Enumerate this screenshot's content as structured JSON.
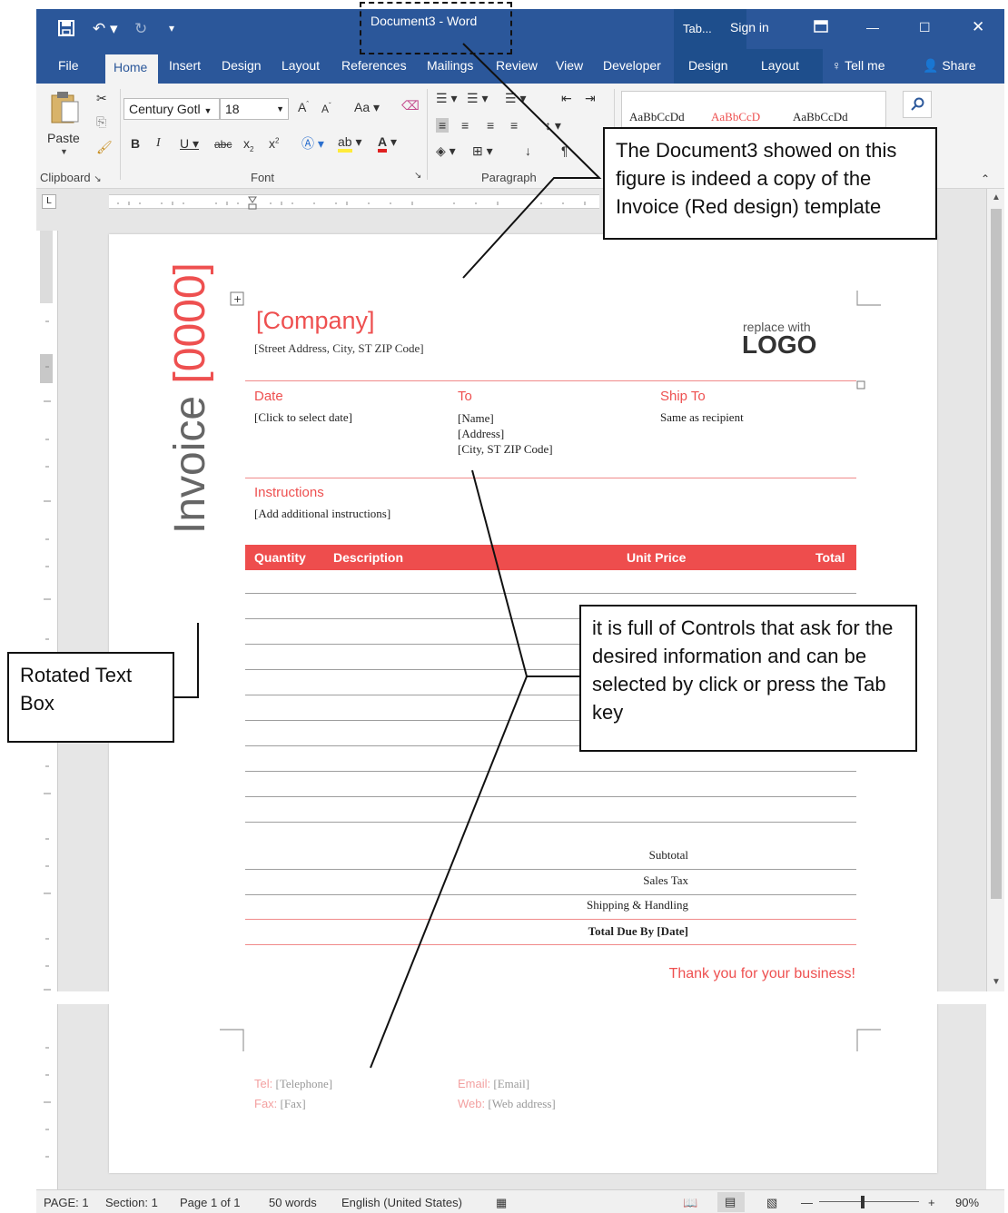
{
  "window": {
    "title": "Document3  -  Word",
    "context_tab_label": "Tab...",
    "sign_in": "Sign in"
  },
  "ribbon_tabs": [
    "File",
    "Home",
    "Insert",
    "Design",
    "Layout",
    "References",
    "Mailings",
    "Review",
    "View",
    "Developer",
    "Design",
    "Layout"
  ],
  "tell_me": "Tell me",
  "share": "Share",
  "clipboard": {
    "paste_label": "Paste",
    "group_label": "Clipboard"
  },
  "font": {
    "font_name": "Century Gotl",
    "font_size": "18",
    "change_case": "Aa",
    "group_label": "Font"
  },
  "paragraph": {
    "group_label": "Paragraph"
  },
  "styles": [
    "AaBbCcDd",
    "AaBbCcD",
    "AaBbCcDd"
  ],
  "invoice": {
    "title_word": "Invoice",
    "title_number": "[0000]",
    "company": "[Company]",
    "address": "[Street Address, City, ST ZIP Code]",
    "logo_top": "replace with",
    "logo": "LOGO",
    "date_label": "Date",
    "date_value": "[Click to select date]",
    "to_label": "To",
    "to_lines": [
      "[Name]",
      "[Address]",
      "[City, ST  ZIP Code]"
    ],
    "ship_label": "Ship To",
    "ship_value": "Same as recipient",
    "instructions_label": "Instructions",
    "instructions_value": "[Add additional instructions]",
    "table_headers": [
      "Quantity",
      "Description",
      "Unit Price",
      "Total"
    ],
    "summary": [
      "Subtotal",
      "Sales Tax",
      "Shipping & Handling",
      "Total Due By [Date]"
    ],
    "thanks": "Thank you for your business!",
    "footer": {
      "tel_label": "Tel:",
      "tel_value": "[Telephone]",
      "fax_label": "Fax:",
      "fax_value": "[Fax]",
      "email_label": "Email:",
      "email_value": "[Email]",
      "web_label": "Web:",
      "web_value": "[Web address]"
    }
  },
  "callouts": {
    "top": "The Document3 showed on this figure is indeed a copy of the Invoice (Red design) template",
    "middle": "it is full of Controls that ask for the desired information and can be selected by click or press the Tab key",
    "left": "Rotated Text Box"
  },
  "status": {
    "page": "PAGE: 1",
    "section": "Section: 1",
    "page_of": "Page 1 of 1",
    "words": "50 words",
    "language": "English (United States)",
    "zoom": "90%"
  },
  "colors": {
    "word_blue": "#2b579a",
    "invoice_red": "#ee4d4d"
  }
}
